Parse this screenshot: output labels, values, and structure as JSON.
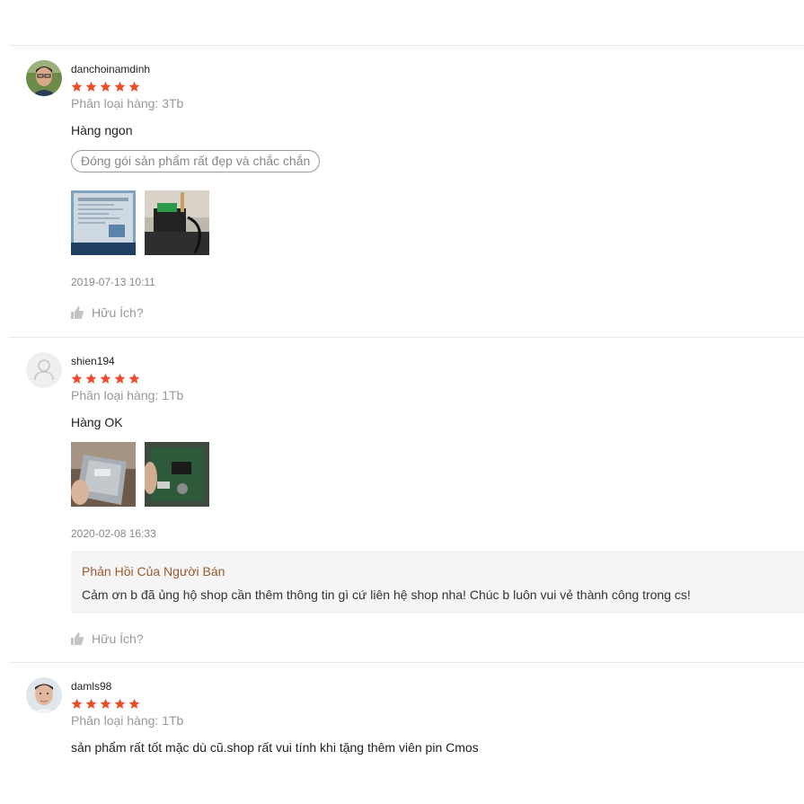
{
  "colors": {
    "star": "#ee4d2d",
    "seller_title": "#9b5a2e"
  },
  "reviews": [
    {
      "username": "danchoinamdinh",
      "rating": 5,
      "variation": "Phân loại hàng: 3Tb",
      "comment": "Hàng ngon",
      "tag": "Đóng gói sản phẩm rất đẹp và chắc chắn",
      "images": [
        "screen-photo",
        "hdd-dock-photo"
      ],
      "timestamp": "2019-07-13 10:11",
      "helpful_label": "Hữu Ích?"
    },
    {
      "username": "shien194",
      "rating": 5,
      "variation": "Phân loại hàng: 1Tb",
      "comment": "Hàng OK",
      "images": [
        "hdd-front-photo",
        "hdd-back-photo"
      ],
      "timestamp": "2020-02-08 16:33",
      "seller_reply": {
        "title": "Phản Hồi Của Người Bán",
        "text": "Cảm ơn b đã ủng hộ shop cần thêm thông tin gì cứ liên hệ shop nha! Chúc b luôn vui vẻ thành công trong cs!"
      },
      "helpful_label": "Hữu Ích?"
    },
    {
      "username": "damls98",
      "rating": 5,
      "variation": "Phân loại hàng: 1Tb",
      "comment": "sản phẩm rất tốt mặc dù cũ.shop rất vui tính khi tặng thêm viên pin Cmos"
    }
  ]
}
